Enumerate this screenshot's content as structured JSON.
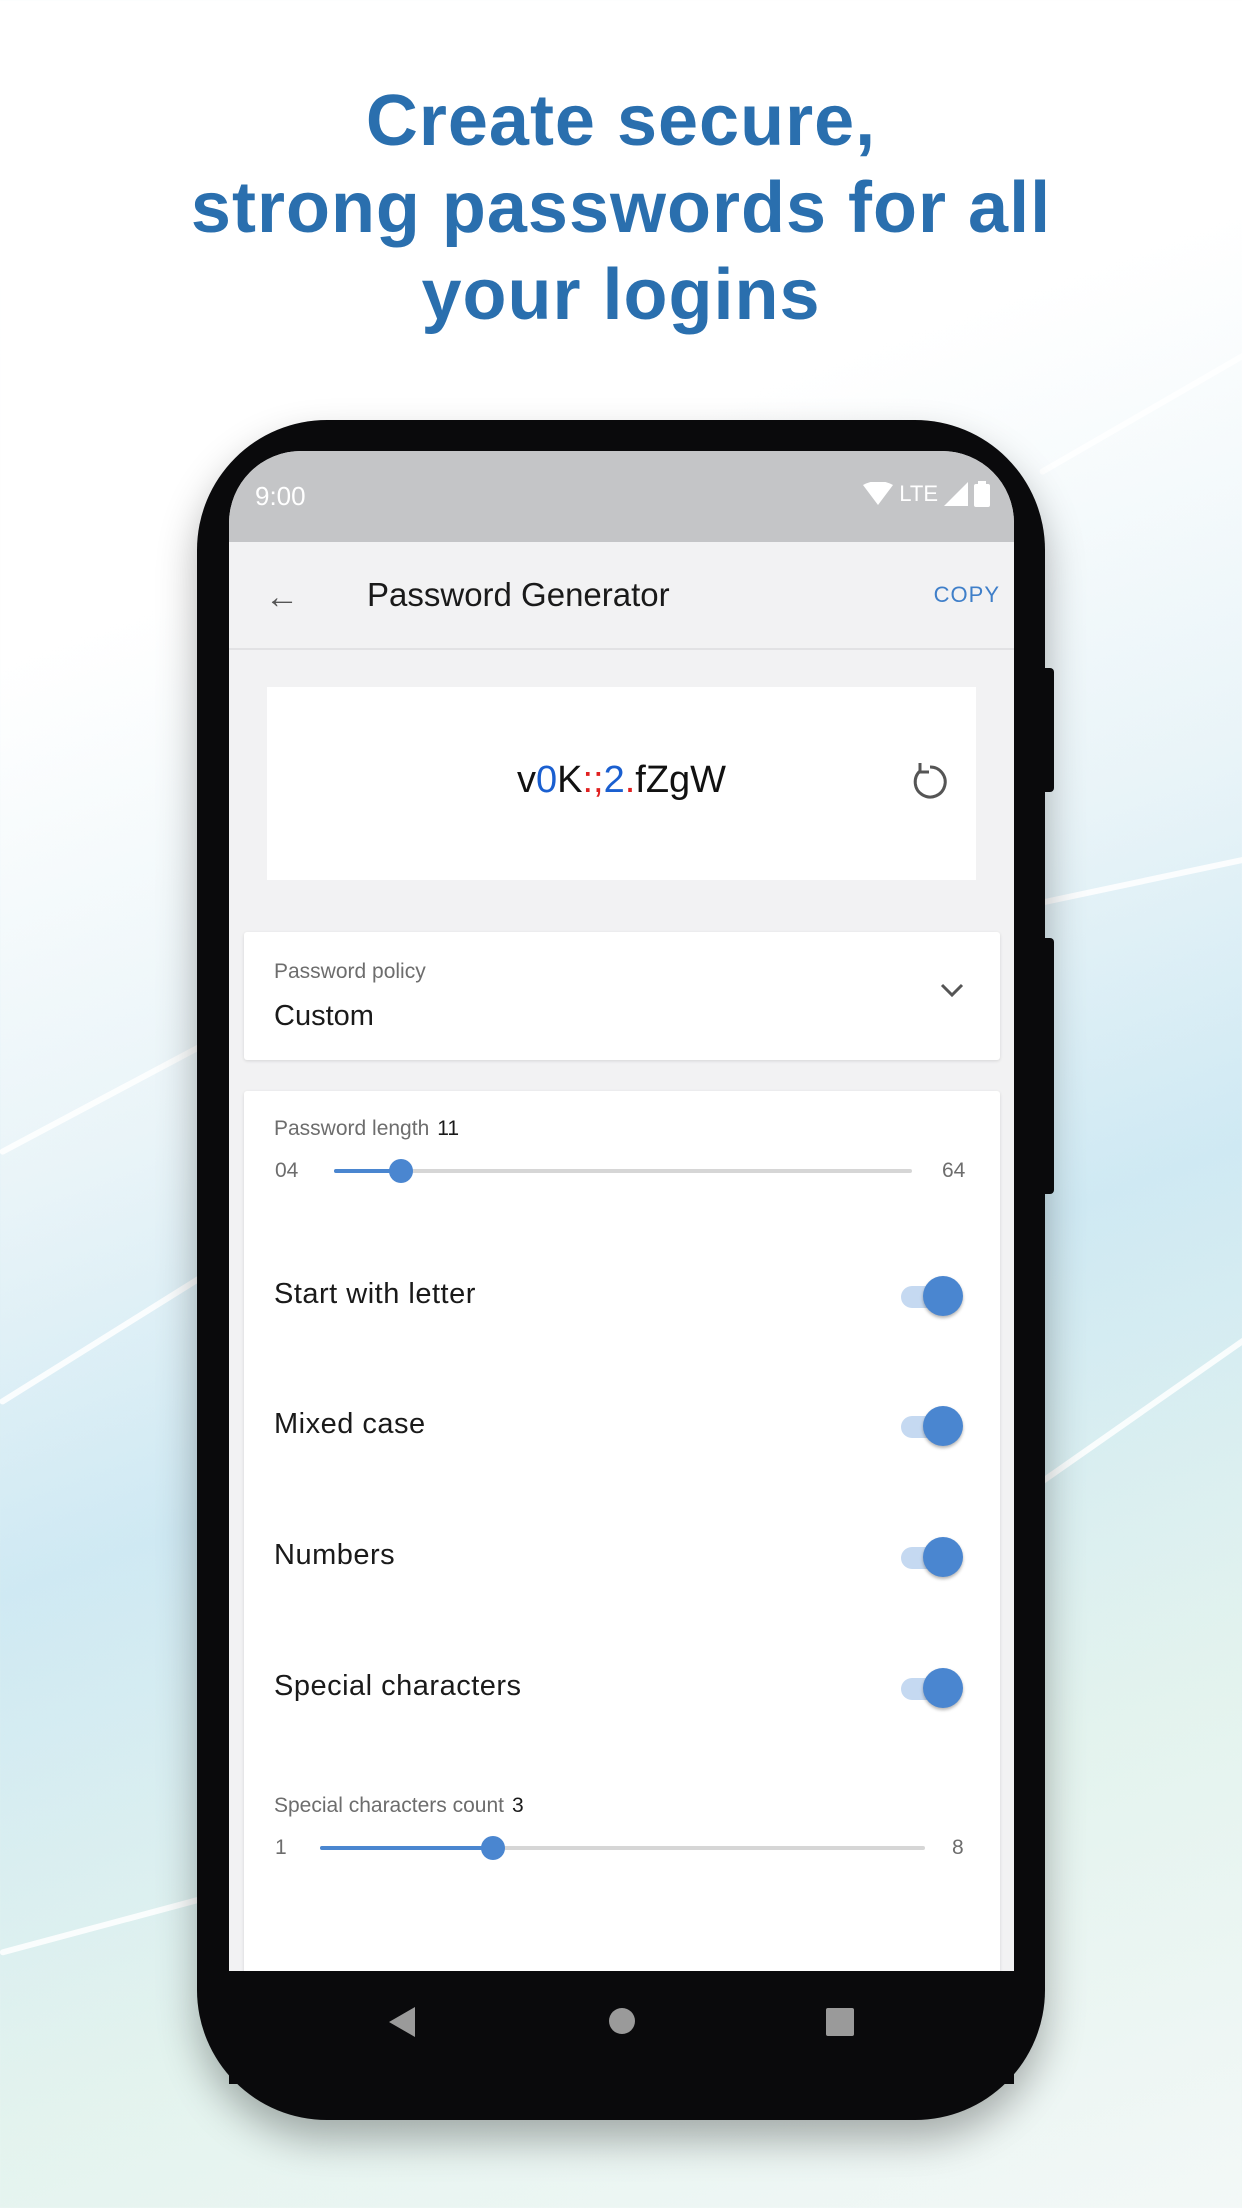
{
  "headline": [
    "Create secure,",
    "strong passwords for all",
    "your logins"
  ],
  "colors": {
    "accent": "#4a86d0",
    "headline": "#2a6fae",
    "password_digit": "#1a5fd0",
    "password_special": "#e02020"
  },
  "status_bar": {
    "time": "9:00",
    "network": "LTE",
    "icons": [
      "wifi-icon",
      "signal-icon",
      "battery-icon"
    ]
  },
  "app_bar": {
    "back_icon": "arrow-left-icon",
    "title": "Password Generator",
    "copy_label": "COPY"
  },
  "password": {
    "segments": [
      {
        "text": "v",
        "type": "letter"
      },
      {
        "text": "0",
        "type": "digit"
      },
      {
        "text": "K",
        "type": "letter"
      },
      {
        "text": ":;",
        "type": "special"
      },
      {
        "text": "2",
        "type": "digit"
      },
      {
        "text": ".",
        "type": "special"
      },
      {
        "text": "fZgW",
        "type": "letter"
      }
    ],
    "refresh_icon": "refresh-icon"
  },
  "policy": {
    "label": "Password policy",
    "value": "Custom"
  },
  "length": {
    "label": "Password length",
    "value": "11",
    "min": "04",
    "max": "64",
    "numeric": {
      "value": 11,
      "min": 4,
      "max": 64
    }
  },
  "toggles": [
    {
      "label": "Start with letter",
      "on": true
    },
    {
      "label": "Mixed case",
      "on": true
    },
    {
      "label": "Numbers",
      "on": true
    },
    {
      "label": "Special characters",
      "on": true
    }
  ],
  "special_count": {
    "label": "Special characters count",
    "value": "3",
    "min": "1",
    "max": "8",
    "numeric": {
      "value": 3,
      "min": 1,
      "max": 8
    }
  },
  "nav_bar": [
    "back-triangle-icon",
    "home-circle-icon",
    "recents-square-icon"
  ]
}
